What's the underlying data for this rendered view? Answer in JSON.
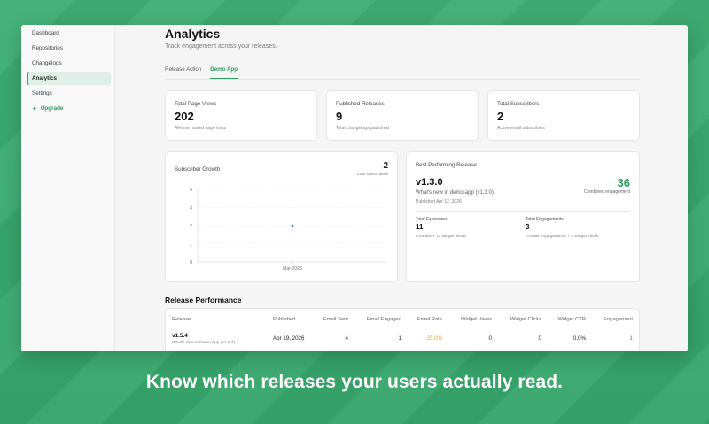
{
  "sidebar": {
    "items": [
      {
        "label": "Dashboard"
      },
      {
        "label": "Repositories"
      },
      {
        "label": "Changelogs"
      },
      {
        "label": "Analytics"
      },
      {
        "label": "Settings"
      }
    ],
    "upgrade_label": "Upgrade"
  },
  "header": {
    "title": "Analytics",
    "subtitle": "Track engagement across your releases."
  },
  "tabs": [
    {
      "label": "Release Action",
      "active": false
    },
    {
      "label": "Demo App",
      "active": true
    }
  ],
  "stats": [
    {
      "label": "Total Page Views",
      "value": "202",
      "desc": "All-time hosted page visits"
    },
    {
      "label": "Published Releases",
      "value": "9",
      "desc": "Total changelogs published"
    },
    {
      "label": "Total Subscribers",
      "value": "2",
      "desc": "Active email subscribers"
    }
  ],
  "subscriber_growth": {
    "title": "Subscriber Growth",
    "total": "2",
    "total_label": "Total subscribers"
  },
  "chart_data": {
    "type": "line",
    "title": "Subscriber Growth",
    "categories": [
      "Mar 2026"
    ],
    "series": [
      {
        "values": [
          2
        ]
      }
    ],
    "yticks": [
      "0",
      "1",
      "2",
      "3",
      "4"
    ],
    "ylim": [
      0,
      4
    ],
    "grid": true,
    "point_color": "#2f9a63"
  },
  "best_release": {
    "title": "Best Performing Release",
    "version": "v1.3.0",
    "name": "What's new in demo-app (v1.3.0)",
    "published": "Published Apr 12, 2026",
    "combined": "36",
    "combined_label": "Combined engagement",
    "exposures_label": "Total Exposures",
    "exposures_value": "11",
    "exposures_desc": "0 emails + 11 widget views",
    "engagements_label": "Total Engagements",
    "engagements_value": "3",
    "engagements_desc": "0 email engagements + 3 widget clicks"
  },
  "release_performance": {
    "title": "Release Performance",
    "columns": [
      "Release",
      "Published",
      "Email Sent",
      "Email Engaged",
      "Email Rate",
      "Widget Views",
      "Widget Clicks",
      "Widget CTR",
      "Engagement"
    ],
    "rows": [
      {
        "version": "v1.5.4",
        "name": "What's new in Demo App (v1.5.4)",
        "published": "Apr 19, 2026",
        "email_sent": "4",
        "email_engaged": "1",
        "email_rate": "25.0%",
        "widget_views": "0",
        "widget_clicks": "0",
        "widget_ctr": "0.0%",
        "engagement": "1"
      }
    ]
  },
  "colors": {
    "accent": "#2f9a63",
    "rate": "#d9a13a",
    "background": "#3aa86f"
  },
  "caption": "Know which releases your users actually read."
}
